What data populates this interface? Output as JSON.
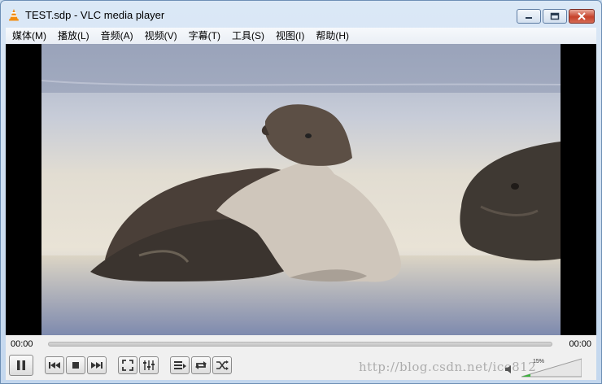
{
  "window": {
    "title": "TEST.sdp - VLC media player"
  },
  "menu": {
    "items": [
      {
        "label": "媒体(M)"
      },
      {
        "label": "播放(L)"
      },
      {
        "label": "音频(A)"
      },
      {
        "label": "视频(V)"
      },
      {
        "label": "字幕(T)"
      },
      {
        "label": "工具(S)"
      },
      {
        "label": "视图(I)"
      },
      {
        "label": "帮助(H)"
      }
    ]
  },
  "player": {
    "elapsed": "00:00",
    "total": "00:00",
    "seek_progress": 0,
    "volume_label": "15%",
    "volume_level": 0.15
  },
  "watermark": {
    "text": "http://blog.csdn.net/ice812"
  },
  "colors": {
    "accent": "#2b7bd1",
    "volume_green": "#3bb33b",
    "close_red": "#c6422b"
  },
  "icons": {
    "app": "vlc-cone-icon",
    "minimize": "minimize-icon",
    "maximize": "maximize-icon",
    "close": "close-icon"
  }
}
